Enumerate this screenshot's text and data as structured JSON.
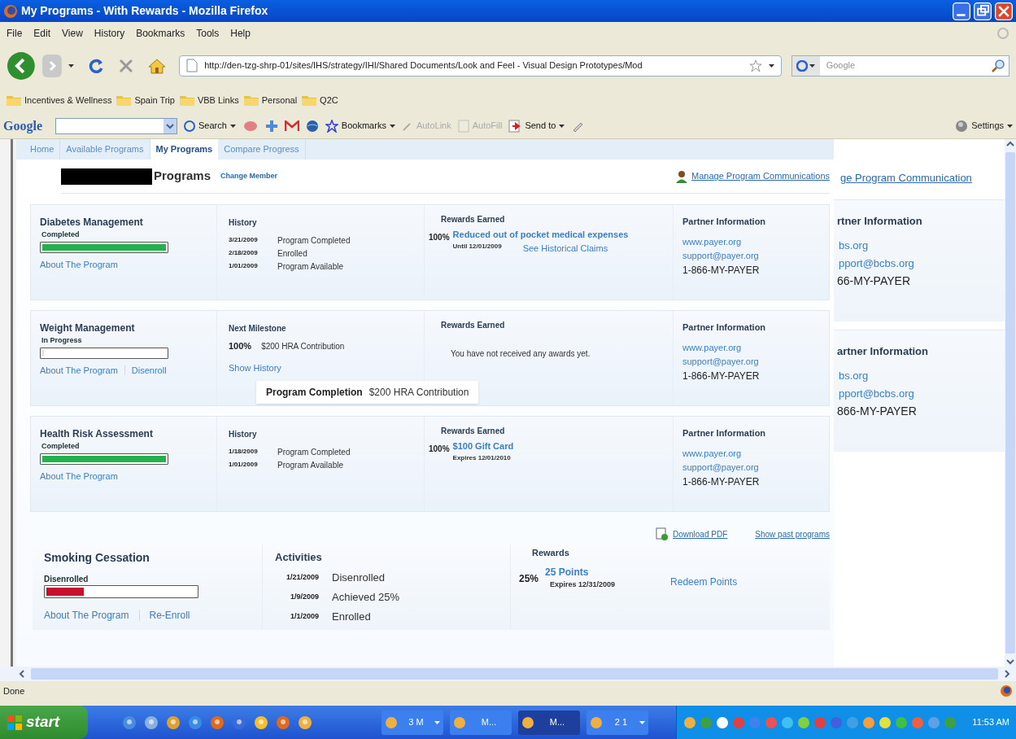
{
  "window": {
    "title": "My Programs - With Rewards - Mozilla Firefox"
  },
  "menu": [
    "File",
    "Edit",
    "View",
    "History",
    "Bookmarks",
    "Tools",
    "Help"
  ],
  "address": {
    "value": "http://den-tzg-shrp-01/sites/IHS/strategy/IHI/Shared Documents/Look and Feel - Visual Design Prototypes/Mod"
  },
  "search": {
    "placeholder": "Google"
  },
  "bookmarks": [
    "Incentives & Wellness",
    "Spain Trip",
    "VBB Links",
    "Personal",
    "Q2C"
  ],
  "google_toolbar": {
    "logo": "Google",
    "buttons": [
      {
        "label": "Search",
        "disabled": false,
        "dropdown": true
      },
      {
        "label": "Bookmarks",
        "disabled": false,
        "dropdown": true
      },
      {
        "label": "AutoLink",
        "disabled": true,
        "dropdown": false
      },
      {
        "label": "AutoFill",
        "disabled": true,
        "dropdown": false
      },
      {
        "label": "Send to",
        "disabled": false,
        "dropdown": true
      }
    ],
    "settings": "Settings"
  },
  "tabs": [
    {
      "label": "Home",
      "selected": false
    },
    {
      "label": "Available Programs",
      "selected": false
    },
    {
      "label": "My Programs",
      "selected": true
    },
    {
      "label": "Compare Progress",
      "selected": false
    }
  ],
  "header": {
    "title": "Programs",
    "change_link": "Change Member",
    "manage_link": "Manage Program Communications"
  },
  "programs": [
    {
      "kind": "history",
      "name": "Diabetes Management",
      "status": "Completed",
      "level": 1,
      "color": "#22b14c",
      "links": [
        "About The Program"
      ],
      "section_title": "History",
      "history": [
        {
          "date": "3/21/2009",
          "event": "Program Completed"
        },
        {
          "date": "2/18/2009",
          "event": "Enrolled"
        },
        {
          "date": "1/01/2009",
          "event": "Program Available"
        }
      ],
      "rewards_title": "Rewards Earned",
      "reward": {
        "percent": "100%",
        "title": "Reduced out of pocket medical expenses",
        "note": "Until 12/01/2009",
        "extra_link": "See Historical Claims"
      },
      "partner": {
        "title": "Partner Information",
        "links": [
          "www.payer.org",
          "support@payer.org"
        ],
        "phone": "1-866-MY-PAYER"
      }
    },
    {
      "kind": "milestone",
      "name": "Weight Management",
      "status": "In Progress",
      "level": 0,
      "links": [
        "About The Program",
        "Disenroll"
      ],
      "section_title": "Next Milestone",
      "milestone": {
        "percent": "100%",
        "text": "$200 HRA Contribution"
      },
      "show_history": "Show History",
      "rewards_title": "Rewards Earned",
      "no_rewards": "You have not received any awards yet.",
      "popup": {
        "title": "Program Completion",
        "text": "$200 HRA Contribution"
      },
      "partner": {
        "title": "Partner Information",
        "links": [
          "www.payer.org",
          "support@payer.org"
        ],
        "phone": "1-866-MY-PAYER"
      }
    },
    {
      "kind": "history",
      "name": "Health Risk Assessment",
      "status": "Completed",
      "level": 1,
      "color": "#22b14c",
      "links": [
        "About The Program"
      ],
      "section_title": "History",
      "history": [
        {
          "date": "1/18/2009",
          "event": "Program Completed"
        },
        {
          "date": "1/01/2009",
          "event": "Program Available"
        }
      ],
      "rewards_title": "Rewards Earned",
      "reward": {
        "percent": "100%",
        "title": "$100 Gift Card",
        "note": "Expires 12/01/2010"
      },
      "partner": {
        "title": "Partner Information",
        "links": [
          "www.payer.org",
          "support@payer.org"
        ],
        "phone": "1-866-MY-PAYER"
      }
    }
  ],
  "footer_links": {
    "download": "Download PDF",
    "past": "Show past programs"
  },
  "smoking": {
    "name": "Smoking Cessation",
    "status": "Disenrolled",
    "level": 0.25,
    "color": "#c8102e",
    "links": [
      "About The Program",
      "Re-Enroll"
    ],
    "activities_title": "Activities",
    "activities": [
      {
        "date": "1/21/2009",
        "event": "Disenrolled"
      },
      {
        "date": "1/9/2009",
        "event": "Achieved 25%"
      },
      {
        "date": "1/1/2009",
        "event": "Enrolled"
      }
    ],
    "rewards_title": "Rewards",
    "reward": {
      "percent": "25%",
      "title": "25 Points",
      "note": "Expires 12/31/2009"
    },
    "redeem": "Redeem Points"
  },
  "background_window": {
    "link": "ge Program Communication",
    "cards": [
      {
        "title": "rtner Information",
        "links": [
          "bs.org",
          "pport@bcbs.org"
        ],
        "phone": "66-MY-PAYER"
      },
      {
        "title": "artner Information",
        "links": [
          "bs.org",
          "pport@bcbs.org"
        ],
        "phone": "866-MY-PAYER"
      }
    ]
  },
  "status_bar": "Done",
  "taskbar": {
    "start": "start",
    "tasks": [
      {
        "label": "3 M",
        "dropdown": true,
        "selected": false
      },
      {
        "label": "M...",
        "dropdown": false,
        "selected": false
      },
      {
        "label": "M...",
        "dropdown": false,
        "selected": true
      },
      {
        "label": "2 1",
        "dropdown": true,
        "selected": false
      }
    ],
    "clock": "11:53 AM"
  }
}
